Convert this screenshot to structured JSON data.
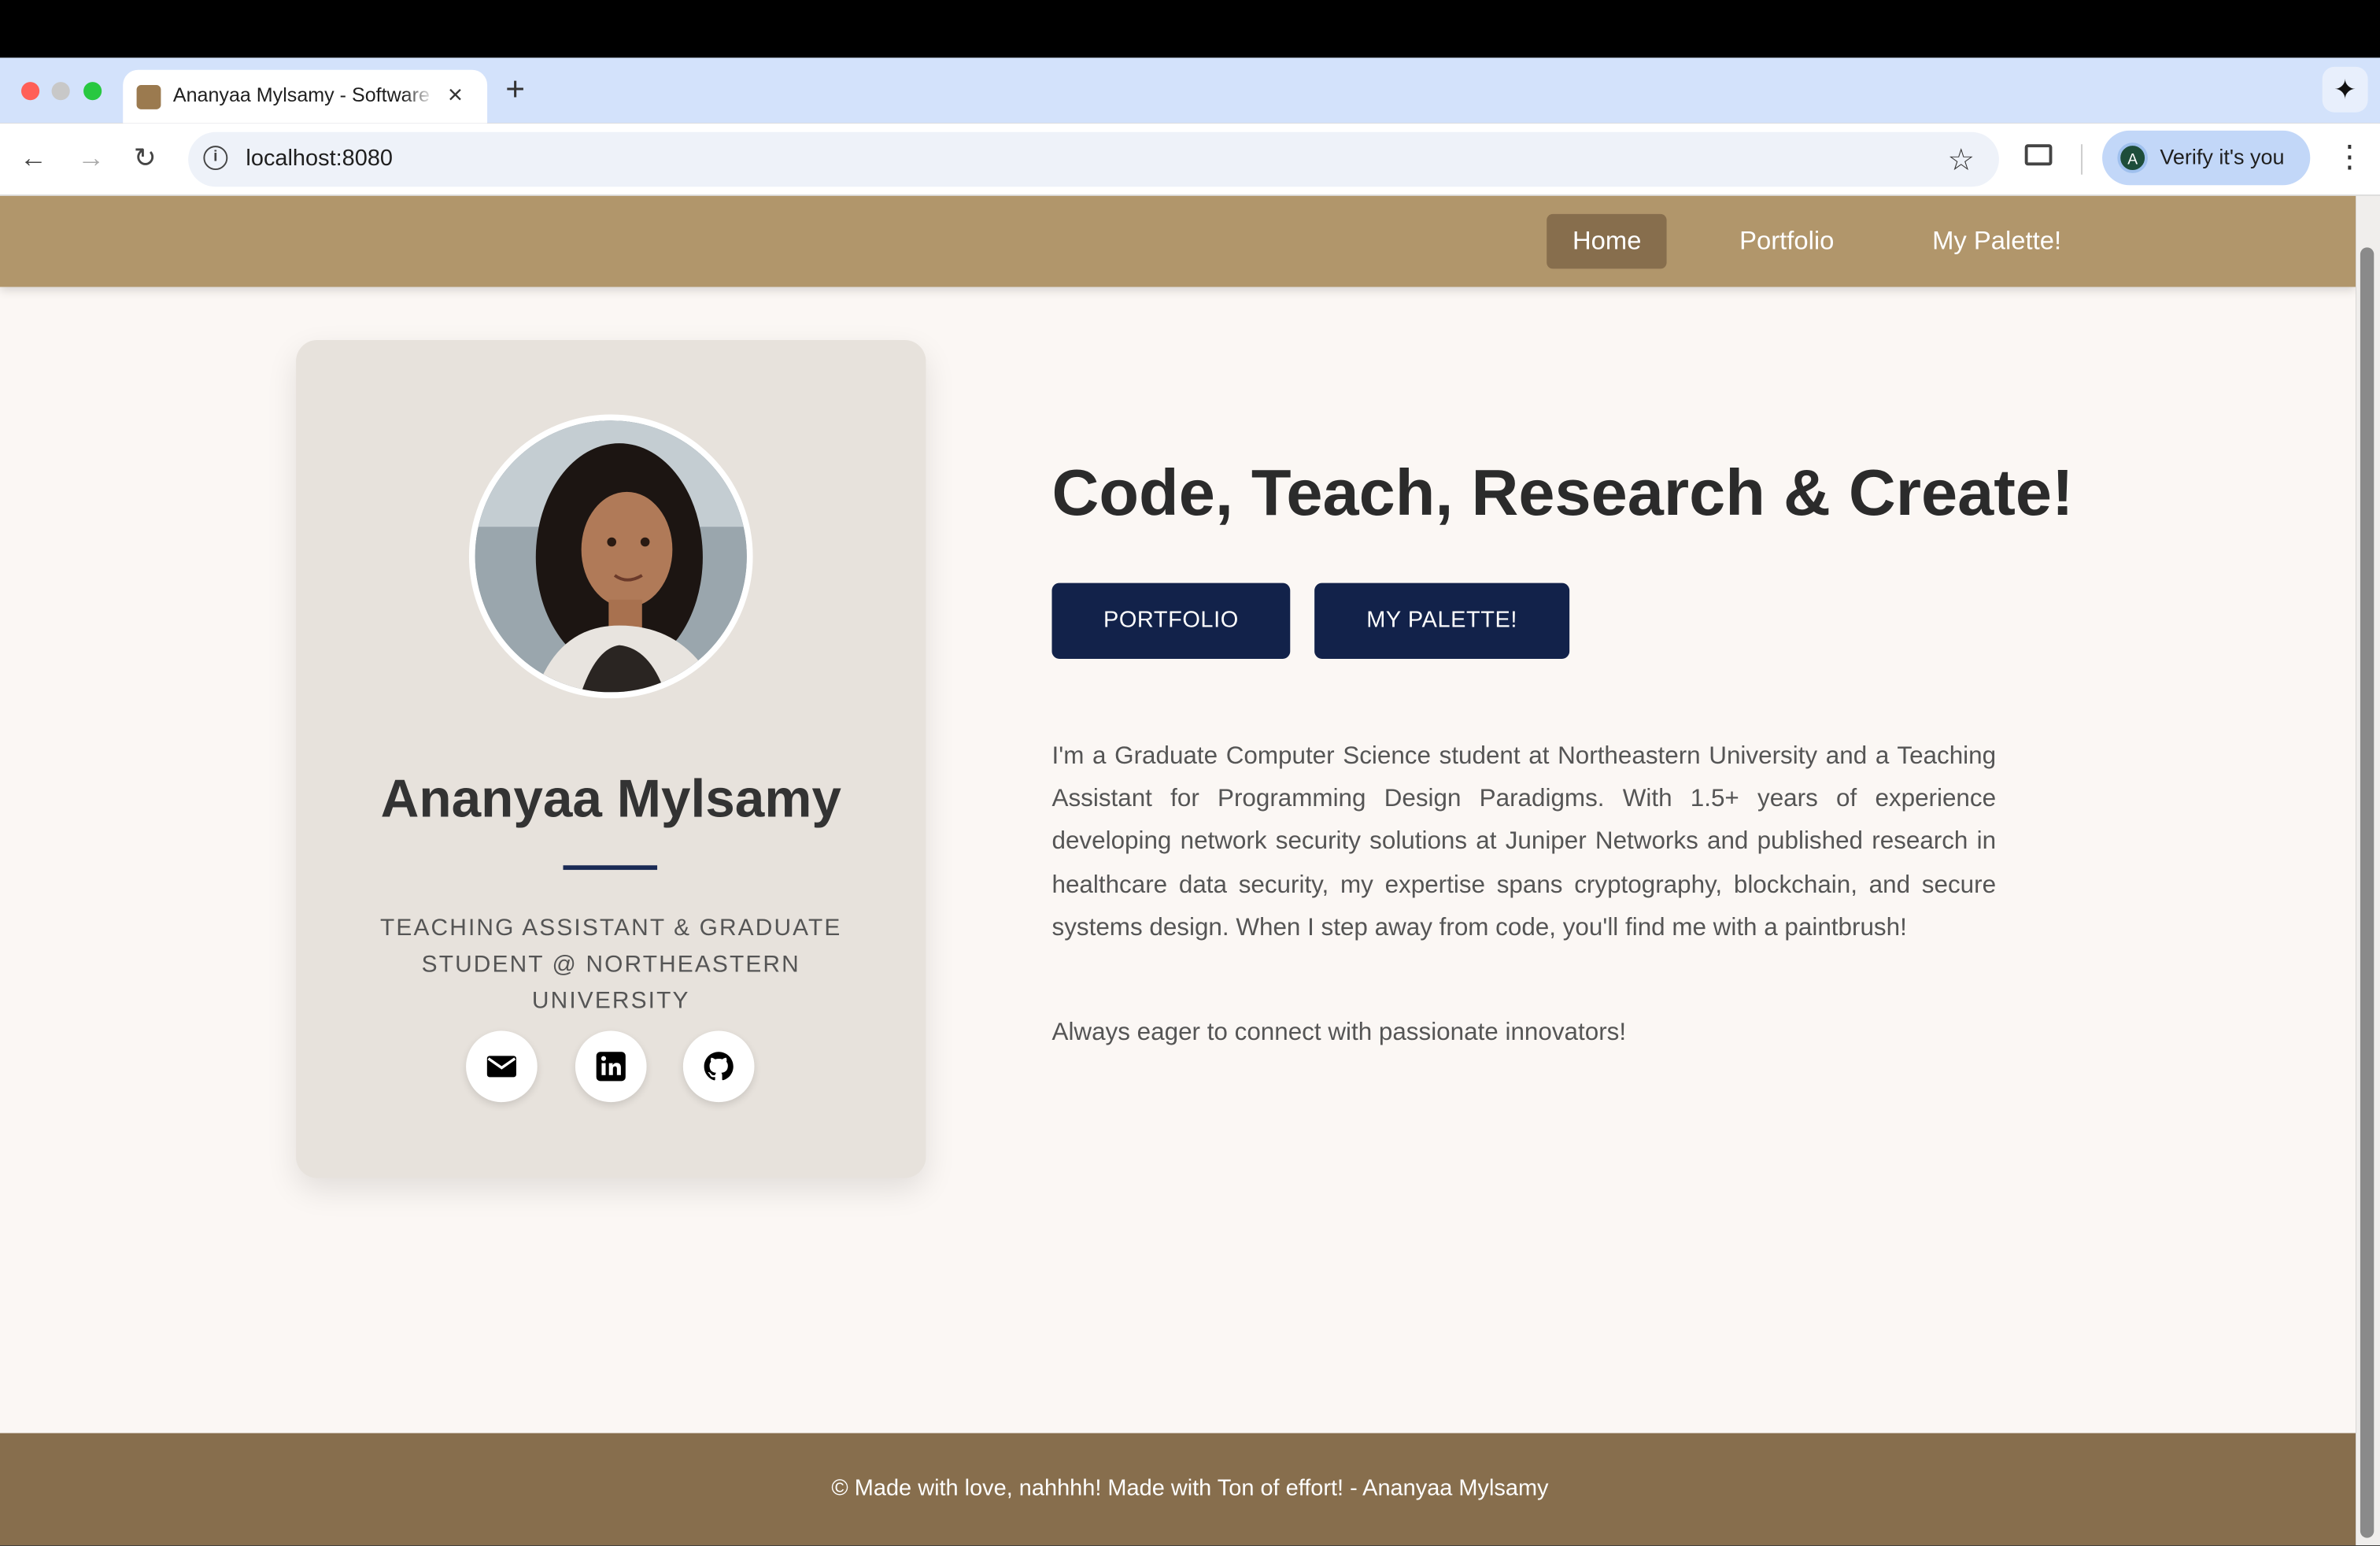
{
  "browser": {
    "tab_title": "Ananyaa Mylsamy - Software",
    "url": "localhost:8080",
    "profile_button_label": "Verify it's you",
    "profile_initial": "A"
  },
  "site_nav": {
    "items": [
      {
        "label": "Home",
        "active": true
      },
      {
        "label": "Portfolio",
        "active": false
      },
      {
        "label": "My Palette!",
        "active": false
      }
    ]
  },
  "profile_card": {
    "name": "Ananyaa Mylsamy",
    "role": "TEACHING ASSISTANT & GRADUATE STUDENT @ NORTHEASTERN UNIVERSITY",
    "social_icons": [
      "envelope-icon",
      "linkedin-icon",
      "github-icon"
    ]
  },
  "hero": {
    "headline": "Code, Teach, Research & Create!",
    "buttons": [
      "PORTFOLIO",
      "MY PALETTE!"
    ],
    "bio": "I'm a Graduate Computer Science student at Northeastern University and a Teaching Assistant for Programming Design Paradigms. With 1.5+ years of experience developing network security solutions at Juniper Networks and published research in healthcare data security, my expertise spans cryptography, blockchain, and secure systems design. When I step away from code, you'll find me with a paintbrush!",
    "bio_closing": "Always eager to connect with passionate innovators!"
  },
  "footer": {
    "text": "© Made with love, nahhhh! Made with Ton of effort! - Ananyaa Mylsamy"
  },
  "colors": {
    "nav_bg": "#b1966b",
    "nav_active": "#876e4d",
    "footer_bg": "#876e4d",
    "button_bg": "#12224a",
    "card_bg": "#e7e2dc",
    "page_bg": "#fbf7f4"
  }
}
